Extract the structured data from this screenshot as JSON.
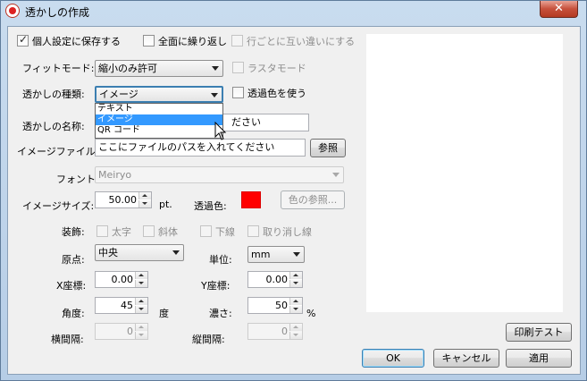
{
  "window": {
    "title": "透かしの作成",
    "close_label": "✕"
  },
  "options": {
    "save_personal": {
      "label": "個人設定に保存する",
      "checked": true
    },
    "tile_all": {
      "label": "全面に繰り返し",
      "checked": false
    },
    "alternate_rows": {
      "label": "行ごとに互い違いにする",
      "checked": false
    }
  },
  "fit_mode": {
    "label": "フィットモード:",
    "value": "縮小のみ許可"
  },
  "raster_mode": {
    "label": "ラスタモード"
  },
  "watermark_type": {
    "label": "透かしの種類:",
    "value": "イメージ",
    "options": [
      "テキスト",
      "イメージ",
      "QR コード"
    ],
    "selected_index": 1
  },
  "use_transparent": {
    "label": "透過色を使う"
  },
  "name": {
    "label": "透かしの名称:",
    "value_tail": "ださい"
  },
  "image_file": {
    "label": "イメージファイル:",
    "placeholder": "ここにファイルのパスを入れてください",
    "browse_label": "参照"
  },
  "font": {
    "label": "フォント:",
    "value": "Meiryo"
  },
  "image_size": {
    "label": "イメージサイズ:",
    "value": "50.00",
    "unit": "pt."
  },
  "transparent_color": {
    "label": "透過色:",
    "color": "#ff0000",
    "pick_label": "色の参照..."
  },
  "decoration": {
    "label": "装飾:",
    "bold": "太字",
    "italic": "斜体",
    "underline": "下線",
    "strikethrough": "取り消し線"
  },
  "origin": {
    "label": "原点:",
    "value": "中央"
  },
  "unit": {
    "label": "単位:",
    "value": "mm"
  },
  "x_coord": {
    "label": "X座標:",
    "value": "0.00"
  },
  "y_coord": {
    "label": "Y座標:",
    "value": "0.00"
  },
  "angle": {
    "label": "角度:",
    "value": "45",
    "unit": "度"
  },
  "density": {
    "label": "濃さ:",
    "value": "50",
    "unit": "%"
  },
  "h_spacing": {
    "label": "横間隔:",
    "value": "0"
  },
  "v_spacing": {
    "label": "縦間隔:",
    "value": "0"
  },
  "buttons": {
    "print_test": "印刷テスト",
    "ok": "OK",
    "cancel": "キャンセル",
    "apply": "適用"
  }
}
